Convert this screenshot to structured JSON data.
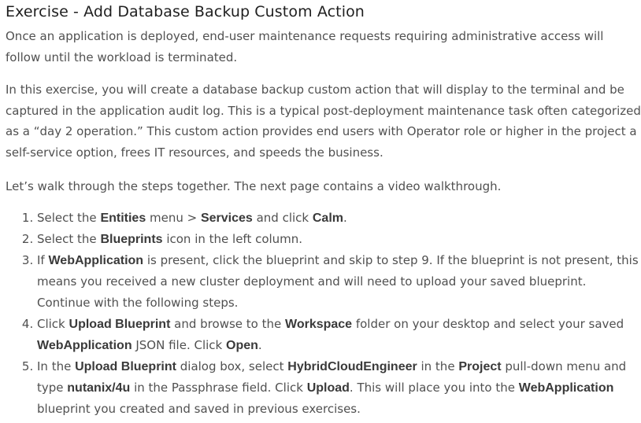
{
  "title": "Exercise - Add Database Backup Custom Action",
  "paragraphs": [
    "Once an application is deployed, end-user maintenance requests requiring administrative access will follow until the workload is terminated.",
    "In this exercise, you will create a database backup custom action that will display to the terminal and be captured in the application audit log. This is a typical post-deployment maintenance task often categorized as a “day 2 operation.” This custom action provides end users with Operator role or higher in the project a self-service option, frees IT resources, and speeds the business.",
    "Let’s walk through the steps together. The next page contains a video walkthrough."
  ],
  "steps": [
    {
      "t0": "Select the ",
      "b0": "Entities",
      "t1": " menu > ",
      "b1": "Services",
      "t2": " and click ",
      "b2": "Calm",
      "t3": "."
    },
    {
      "t0": "Select the ",
      "b0": "Blueprints",
      "t1": " icon in the left column."
    },
    {
      "t0": "If ",
      "b0": "WebApplication",
      "t1": " is present, click the blueprint and skip to step 9. If the blueprint is not present, this means you received a new cluster deployment and will need to upload your saved blueprint. Continue with the following steps."
    },
    {
      "t0": "Click ",
      "b0": "Upload Blueprint",
      "t1": " and browse to the ",
      "b1": "Workspace",
      "t2": " folder on your desktop and select your saved ",
      "b2": "WebApplication",
      "t3": " JSON file. Click ",
      "b3": "Open",
      "t4": "."
    },
    {
      "t0": "In the ",
      "b0": "Upload Blueprint",
      "t1": " dialog box, select ",
      "b1": "HybridCloudEngineer",
      "t2": " in the ",
      "b2": "Project",
      "t3": " pull-down menu and type ",
      "b3": "nutanix/4u",
      "t4": " in the Passphrase field. Click ",
      "b4": "Upload",
      "t5": ". This will place you into the ",
      "b5": "WebApplication",
      "t6": " blueprint you created and saved in previous exercises."
    }
  ]
}
